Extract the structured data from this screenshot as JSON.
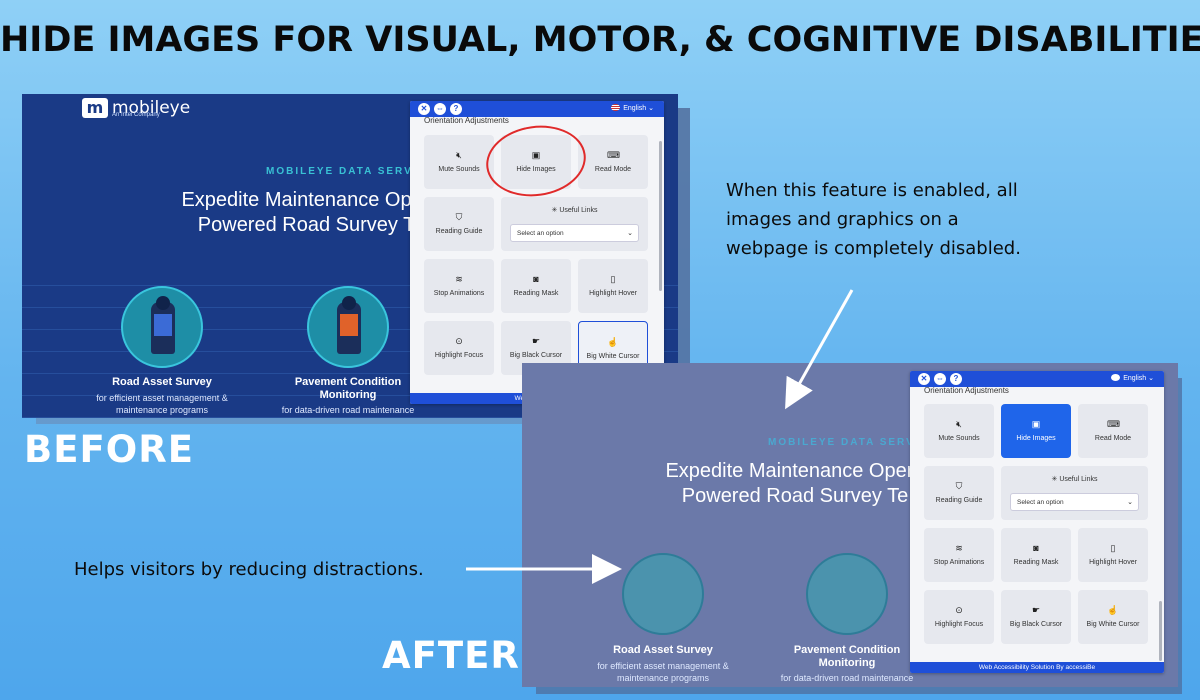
{
  "title": "HIDE IMAGES FOR VISUAL, MOTOR, & COGNITIVE DISABILITIES",
  "labels": {
    "before": "BEFORE",
    "after": "AFTER"
  },
  "notes": {
    "feature": [
      "When this feature is enabled, all",
      "images and graphics on a",
      "webpage is completely disabled."
    ],
    "helps": "Helps visitors by reducing distractions."
  },
  "site": {
    "logo_mark": "m",
    "logo_text": "mobileye",
    "logo_sub": "An Intel Company",
    "eyebrow": "MOBILEYE DATA SERVIC",
    "headline_1": "Expedite Maintenance Opera",
    "headline_2": "Powered Road Survey Te",
    "headline_after_1": "Expedite Maintenance Opera",
    "headline_after_2": "Powered Road Survey Te",
    "card1_title": "Road Asset Survey",
    "card1_sub_1": "for efficient asset management &",
    "card1_sub_2": "maintenance programs",
    "card2_title_1": "Pavement Condition",
    "card2_title_2": "Monitoring",
    "card2_sub": "for data-driven road maintenance"
  },
  "widget": {
    "close": "✕",
    "swap": "⇔",
    "help": "?",
    "language": "English",
    "section": "Orientation Adjustments",
    "tiles": {
      "mute": "Mute Sounds",
      "hide_images": "Hide Images",
      "read_mode": "Read Mode",
      "reading_guide": "Reading Guide",
      "useful_links": "Useful Links",
      "select_placeholder": "Select an option",
      "stop_animations": "Stop Animations",
      "reading_mask": "Reading Mask",
      "highlight_hover": "Highlight Hover",
      "highlight_focus": "Highlight Focus",
      "big_black_cursor": "Big Black Cursor",
      "big_white_cursor": "Big White Cursor"
    },
    "footer_before": "Web Accessibili",
    "footer_after": "Web Accessibility Solution By accessiBe"
  },
  "colors": {
    "accent": "#1f4fd8",
    "selected": "#1f65ea",
    "red_circle": "#e02a2a",
    "site_bg": "#1a3a86",
    "after_bg": "#6b79a9"
  }
}
